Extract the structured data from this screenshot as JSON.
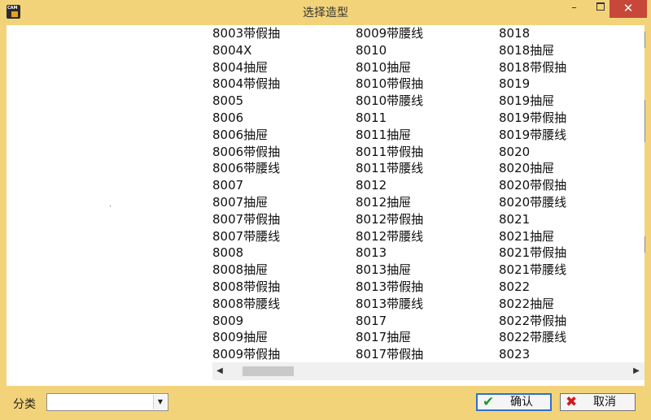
{
  "window": {
    "title": "选择造型",
    "icon_text": "CAM",
    "minimize_glyph": "–",
    "close_glyph": "✕"
  },
  "list": {
    "columns": [
      [
        "8003带假抽",
        "8004X",
        "8004抽屉",
        "8004带假抽",
        "8005",
        "8006",
        "8006抽屉",
        "8006带假抽",
        "8006带腰线",
        "8007",
        "8007抽屉",
        "8007带假抽",
        "8007带腰线",
        "8008",
        "8008抽屉",
        "8008带假抽",
        "8008带腰线",
        "8009",
        "8009抽屉",
        "8009带假抽"
      ],
      [
        "8009带腰线",
        "8010",
        "8010抽屉",
        "8010带假抽",
        "8010带腰线",
        "8011",
        "8011抽屉",
        "8011带假抽",
        "8011带腰线",
        "8012",
        "8012抽屉",
        "8012带假抽",
        "8012带腰线",
        "8013",
        "8013抽屉",
        "8013带假抽",
        "8013带腰线",
        "8017",
        "8017抽屉",
        "8017带假抽"
      ],
      [
        "8018",
        "8018抽屉",
        "8018带假抽",
        "8019",
        "8019抽屉",
        "8019带假抽",
        "8019带腰线",
        "8020",
        "8020抽屉",
        "8020带假抽",
        "8020带腰线",
        "8021",
        "8021抽屉",
        "8021带假抽",
        "8021带腰线",
        "8022",
        "8022抽屉",
        "8022带假抽",
        "8022带腰线",
        "8023"
      ]
    ],
    "scroll_left_glyph": "◀",
    "scroll_right_glyph": "▶"
  },
  "footer": {
    "category_label": "分类",
    "category_value": "",
    "dropdown_glyph": "▼",
    "ok_label": "确认",
    "ok_icon": "✔",
    "cancel_label": "取消",
    "cancel_icon": "✖"
  },
  "colors": {
    "frame": "#f3d37a",
    "close_button": "#c7473a",
    "ok_icon": "#1a9a2b",
    "cancel_icon": "#d11a1a",
    "focus_border": "#2f6fcc"
  }
}
